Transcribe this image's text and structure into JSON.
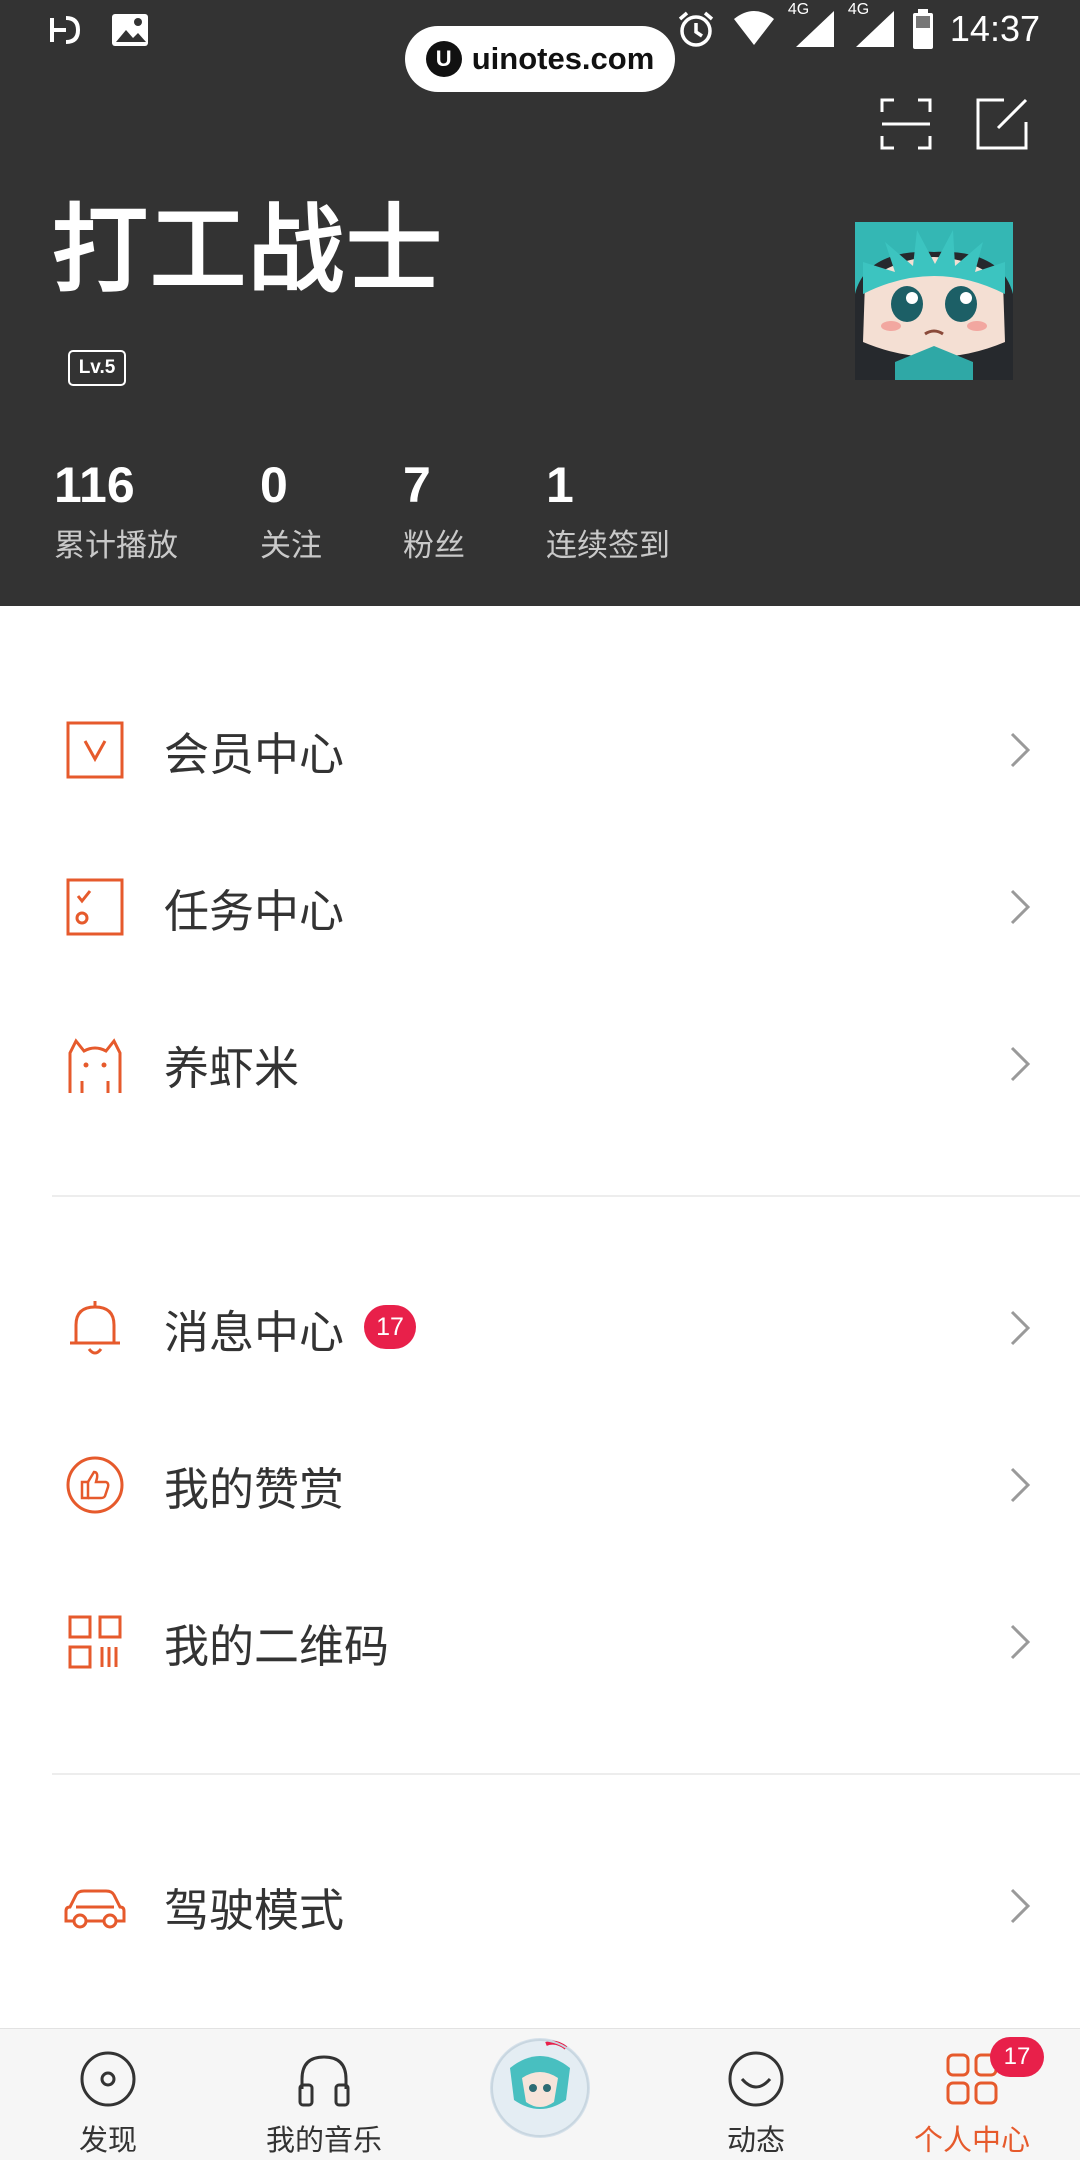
{
  "status_bar": {
    "time": "14:37",
    "network_1": "4G",
    "network_2": "4G"
  },
  "watermark": {
    "logo_letter": "U",
    "text": "uinotes.com"
  },
  "profile": {
    "username": "打工战士",
    "level": "Lv.5",
    "stats": [
      {
        "value": "116",
        "label": "累计播放"
      },
      {
        "value": "0",
        "label": "关注"
      },
      {
        "value": "7",
        "label": "粉丝"
      },
      {
        "value": "1",
        "label": "连续签到"
      }
    ]
  },
  "menu": {
    "group1": [
      {
        "label": "会员中心",
        "icon": "vip-icon"
      },
      {
        "label": "任务中心",
        "icon": "task-checklist-icon"
      },
      {
        "label": "养虾米",
        "icon": "cat-icon"
      }
    ],
    "group2": [
      {
        "label": "消息中心",
        "icon": "bell-icon",
        "badge": "17"
      },
      {
        "label": "我的赞赏",
        "icon": "thumbs-up-icon"
      },
      {
        "label": "我的二维码",
        "icon": "qr-code-icon"
      }
    ],
    "group3": [
      {
        "label": "驾驶模式",
        "icon": "car-icon"
      }
    ]
  },
  "tabbar": {
    "tabs": [
      {
        "label": "发现",
        "icon": "disc-discover-icon"
      },
      {
        "label": "我的音乐",
        "icon": "headphones-icon"
      },
      {
        "label": "",
        "icon": "now-playing-disc"
      },
      {
        "label": "动态",
        "icon": "smile-face-icon"
      },
      {
        "label": "个人中心",
        "icon": "grid-profile-icon",
        "badge": "17",
        "active": true
      }
    ]
  },
  "colors": {
    "header_bg": "#333333",
    "accent": "#e65a2c",
    "badge": "#e8204a"
  }
}
